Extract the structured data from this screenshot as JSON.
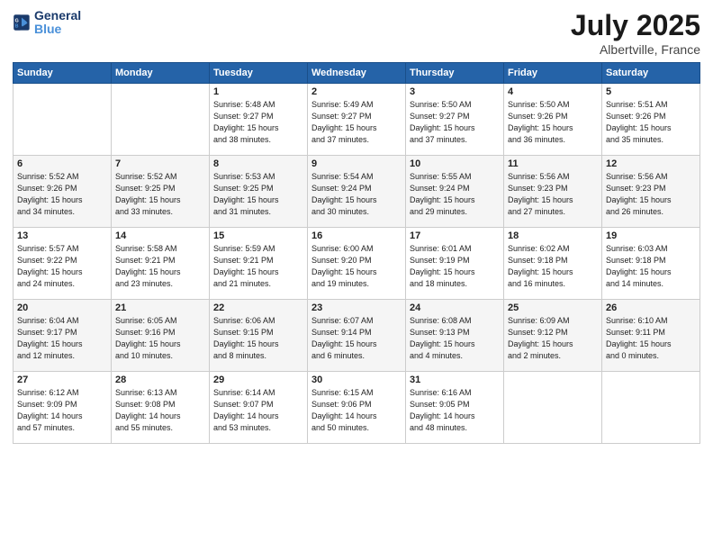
{
  "logo": {
    "line1": "General",
    "line2": "Blue"
  },
  "title": "July 2025",
  "location": "Albertville, France",
  "weekdays": [
    "Sunday",
    "Monday",
    "Tuesday",
    "Wednesday",
    "Thursday",
    "Friday",
    "Saturday"
  ],
  "weeks": [
    [
      {
        "day": "",
        "info": ""
      },
      {
        "day": "",
        "info": ""
      },
      {
        "day": "1",
        "info": "Sunrise: 5:48 AM\nSunset: 9:27 PM\nDaylight: 15 hours\nand 38 minutes."
      },
      {
        "day": "2",
        "info": "Sunrise: 5:49 AM\nSunset: 9:27 PM\nDaylight: 15 hours\nand 37 minutes."
      },
      {
        "day": "3",
        "info": "Sunrise: 5:50 AM\nSunset: 9:27 PM\nDaylight: 15 hours\nand 37 minutes."
      },
      {
        "day": "4",
        "info": "Sunrise: 5:50 AM\nSunset: 9:26 PM\nDaylight: 15 hours\nand 36 minutes."
      },
      {
        "day": "5",
        "info": "Sunrise: 5:51 AM\nSunset: 9:26 PM\nDaylight: 15 hours\nand 35 minutes."
      }
    ],
    [
      {
        "day": "6",
        "info": "Sunrise: 5:52 AM\nSunset: 9:26 PM\nDaylight: 15 hours\nand 34 minutes."
      },
      {
        "day": "7",
        "info": "Sunrise: 5:52 AM\nSunset: 9:25 PM\nDaylight: 15 hours\nand 33 minutes."
      },
      {
        "day": "8",
        "info": "Sunrise: 5:53 AM\nSunset: 9:25 PM\nDaylight: 15 hours\nand 31 minutes."
      },
      {
        "day": "9",
        "info": "Sunrise: 5:54 AM\nSunset: 9:24 PM\nDaylight: 15 hours\nand 30 minutes."
      },
      {
        "day": "10",
        "info": "Sunrise: 5:55 AM\nSunset: 9:24 PM\nDaylight: 15 hours\nand 29 minutes."
      },
      {
        "day": "11",
        "info": "Sunrise: 5:56 AM\nSunset: 9:23 PM\nDaylight: 15 hours\nand 27 minutes."
      },
      {
        "day": "12",
        "info": "Sunrise: 5:56 AM\nSunset: 9:23 PM\nDaylight: 15 hours\nand 26 minutes."
      }
    ],
    [
      {
        "day": "13",
        "info": "Sunrise: 5:57 AM\nSunset: 9:22 PM\nDaylight: 15 hours\nand 24 minutes."
      },
      {
        "day": "14",
        "info": "Sunrise: 5:58 AM\nSunset: 9:21 PM\nDaylight: 15 hours\nand 23 minutes."
      },
      {
        "day": "15",
        "info": "Sunrise: 5:59 AM\nSunset: 9:21 PM\nDaylight: 15 hours\nand 21 minutes."
      },
      {
        "day": "16",
        "info": "Sunrise: 6:00 AM\nSunset: 9:20 PM\nDaylight: 15 hours\nand 19 minutes."
      },
      {
        "day": "17",
        "info": "Sunrise: 6:01 AM\nSunset: 9:19 PM\nDaylight: 15 hours\nand 18 minutes."
      },
      {
        "day": "18",
        "info": "Sunrise: 6:02 AM\nSunset: 9:18 PM\nDaylight: 15 hours\nand 16 minutes."
      },
      {
        "day": "19",
        "info": "Sunrise: 6:03 AM\nSunset: 9:18 PM\nDaylight: 15 hours\nand 14 minutes."
      }
    ],
    [
      {
        "day": "20",
        "info": "Sunrise: 6:04 AM\nSunset: 9:17 PM\nDaylight: 15 hours\nand 12 minutes."
      },
      {
        "day": "21",
        "info": "Sunrise: 6:05 AM\nSunset: 9:16 PM\nDaylight: 15 hours\nand 10 minutes."
      },
      {
        "day": "22",
        "info": "Sunrise: 6:06 AM\nSunset: 9:15 PM\nDaylight: 15 hours\nand 8 minutes."
      },
      {
        "day": "23",
        "info": "Sunrise: 6:07 AM\nSunset: 9:14 PM\nDaylight: 15 hours\nand 6 minutes."
      },
      {
        "day": "24",
        "info": "Sunrise: 6:08 AM\nSunset: 9:13 PM\nDaylight: 15 hours\nand 4 minutes."
      },
      {
        "day": "25",
        "info": "Sunrise: 6:09 AM\nSunset: 9:12 PM\nDaylight: 15 hours\nand 2 minutes."
      },
      {
        "day": "26",
        "info": "Sunrise: 6:10 AM\nSunset: 9:11 PM\nDaylight: 15 hours\nand 0 minutes."
      }
    ],
    [
      {
        "day": "27",
        "info": "Sunrise: 6:12 AM\nSunset: 9:09 PM\nDaylight: 14 hours\nand 57 minutes."
      },
      {
        "day": "28",
        "info": "Sunrise: 6:13 AM\nSunset: 9:08 PM\nDaylight: 14 hours\nand 55 minutes."
      },
      {
        "day": "29",
        "info": "Sunrise: 6:14 AM\nSunset: 9:07 PM\nDaylight: 14 hours\nand 53 minutes."
      },
      {
        "day": "30",
        "info": "Sunrise: 6:15 AM\nSunset: 9:06 PM\nDaylight: 14 hours\nand 50 minutes."
      },
      {
        "day": "31",
        "info": "Sunrise: 6:16 AM\nSunset: 9:05 PM\nDaylight: 14 hours\nand 48 minutes."
      },
      {
        "day": "",
        "info": ""
      },
      {
        "day": "",
        "info": ""
      }
    ]
  ]
}
